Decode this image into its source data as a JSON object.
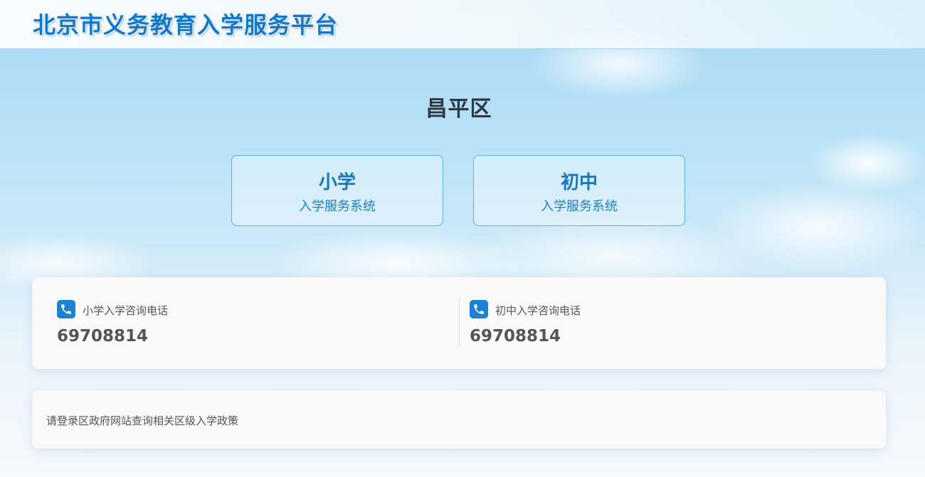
{
  "header": {
    "title": "北京市义务教育入学服务平台"
  },
  "district": {
    "name": "昌平区"
  },
  "systems": [
    {
      "title": "小学",
      "subtitle": "入学服务系统"
    },
    {
      "title": "初中",
      "subtitle": "入学服务系统"
    }
  ],
  "hotlines": [
    {
      "label": "小学入学咨询电话",
      "number": "69708814",
      "icon": "phone-icon"
    },
    {
      "label": "初中入学咨询电话",
      "number": "69708814",
      "icon": "phone-icon"
    }
  ],
  "notice": {
    "text": "请登录区政府网站查询相关区级入学政策"
  },
  "colors": {
    "accent": "#1677c7",
    "icon_bg": "#1a82d6",
    "title": "#0f78d2"
  }
}
